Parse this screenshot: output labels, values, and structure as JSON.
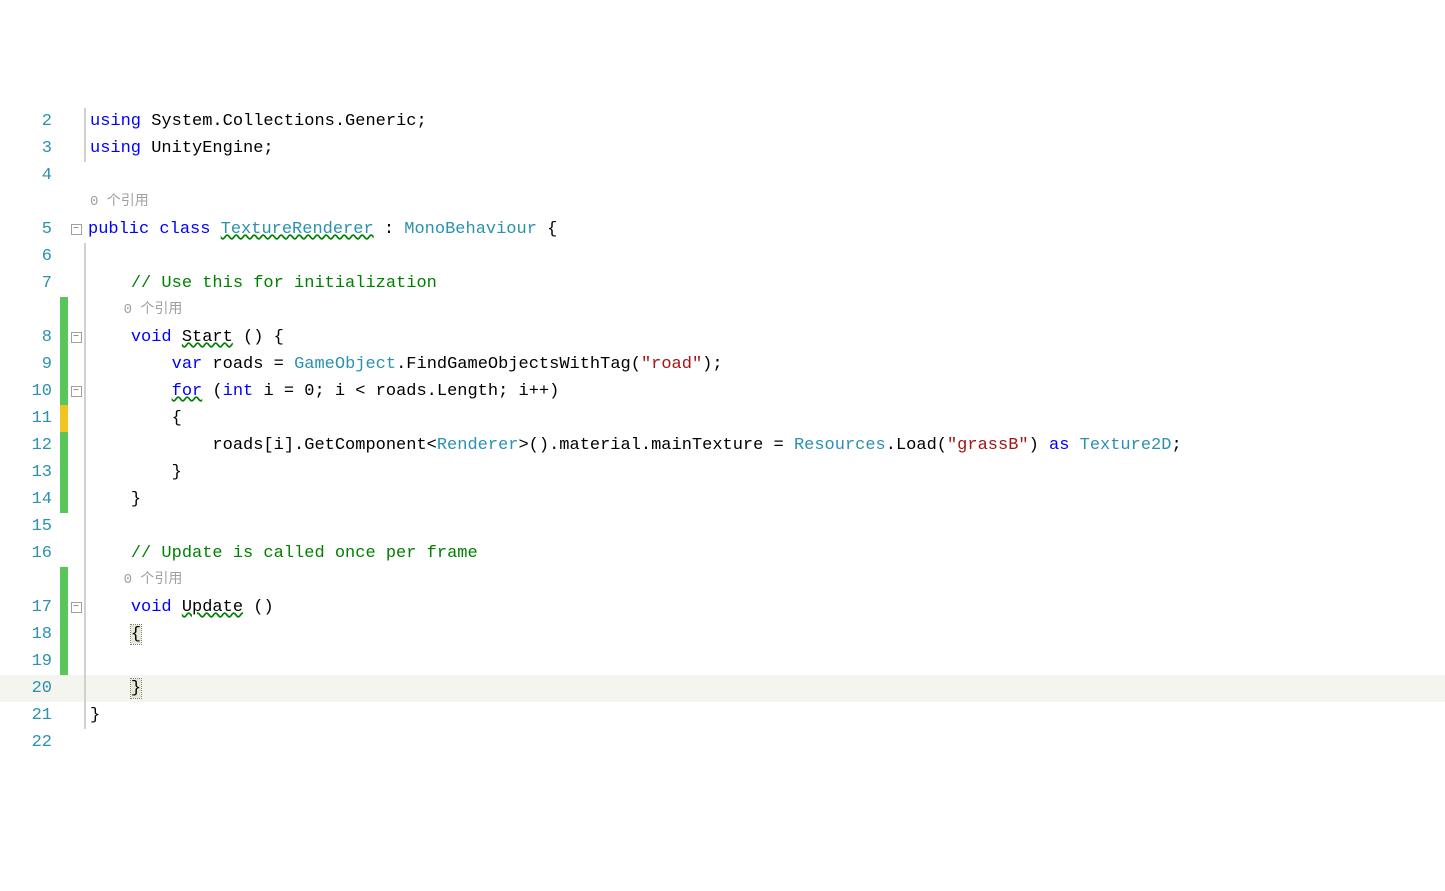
{
  "lines": {
    "l2": {
      "num": "2"
    },
    "l3": {
      "num": "3"
    },
    "l4": {
      "num": "4"
    },
    "l5": {
      "num": "5"
    },
    "l6": {
      "num": "6"
    },
    "l7": {
      "num": "7"
    },
    "l8": {
      "num": "8"
    },
    "l9": {
      "num": "9"
    },
    "l10": {
      "num": "10"
    },
    "l11": {
      "num": "11"
    },
    "l12": {
      "num": "12"
    },
    "l13": {
      "num": "13"
    },
    "l14": {
      "num": "14"
    },
    "l15": {
      "num": "15"
    },
    "l16": {
      "num": "16"
    },
    "l17": {
      "num": "17"
    },
    "l18": {
      "num": "18"
    },
    "l19": {
      "num": "19"
    },
    "l20": {
      "num": "20"
    },
    "l21": {
      "num": "21"
    },
    "l22": {
      "num": "22"
    }
  },
  "kw": {
    "using": "using",
    "public": "public",
    "class": "class",
    "void": "void",
    "var": "var",
    "for": "for",
    "int": "int",
    "as": "as"
  },
  "txt": {
    "sys_coll_generic": " System.Collections.Generic;",
    "unity_engine": " UnityEngine;",
    "space": " ",
    "texture_renderer": "TextureRenderer",
    "colon_space": " : ",
    "monobehaviour": "MonoBehaviour",
    "obrace": " {",
    "comment_init": "// Use this for initialization",
    "start": "Start",
    "start_sig": " () {",
    "roads_eq": " roads = ",
    "gameobject": "GameObject",
    "find_tag": ".FindGameObjectsWithTag(",
    "road_str": "\"road\"",
    "close_paren_semi": ");",
    "for_open": " (",
    "i_eq_0": " i = 0; i < roads.Length; i++)",
    "just_obrace": "{",
    "roads_i": "roads[i].GetComponent<",
    "renderer": "Renderer",
    "material_main": ">().material.mainTexture = ",
    "resources": "Resources",
    "dot_load": ".Load(",
    "grassb": "\"grassB\"",
    "close_paren_sp": ") ",
    "texture2d": "Texture2D",
    "semi": ";",
    "just_cbrace": "}",
    "comment_update": "// Update is called once per frame",
    "update": "Update",
    "update_sig": " ()",
    "codelens_refs": "0 个引用"
  }
}
